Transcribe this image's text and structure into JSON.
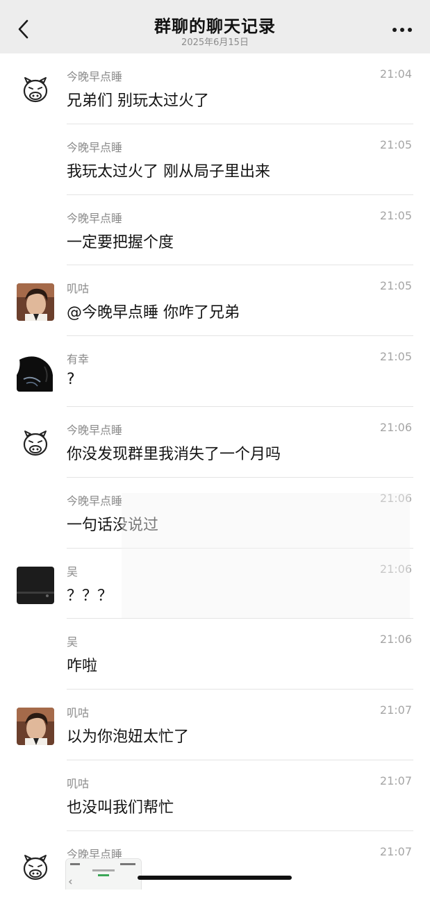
{
  "header": {
    "title": "群聊的聊天记录",
    "date": "2025年6月15日",
    "back_icon": "chevron-left-icon",
    "more_icon": "more-horizontal-icon",
    "background": "#ededed"
  },
  "messages": [
    {
      "sender": "今晚早点睡",
      "time": "21:04",
      "text": "兄弟们 别玩太过火了",
      "avatar": "pig"
    },
    {
      "sender": "今晚早点睡",
      "time": "21:05",
      "text": "我玩太过火了 刚从局子里出来",
      "avatar": ""
    },
    {
      "sender": "今晚早点睡",
      "time": "21:05",
      "text": "一定要把握个度",
      "avatar": ""
    },
    {
      "sender": "叽咕",
      "time": "21:05",
      "text": "@今晚早点睡 你咋了兄弟",
      "avatar": "portrait"
    },
    {
      "sender": "有幸",
      "time": "21:05",
      "text": "?",
      "avatar": "dark"
    },
    {
      "sender": "今晚早点睡",
      "time": "21:06",
      "text": "你没发现群里我消失了一个月吗",
      "avatar": "pig"
    },
    {
      "sender": "今晚早点睡",
      "time": "21:06",
      "text": "一句话没说过",
      "avatar": ""
    },
    {
      "sender": "吴",
      "time": "21:06",
      "text": "？？？",
      "avatar": "device"
    },
    {
      "sender": "吴",
      "time": "21:06",
      "text": "咋啦",
      "avatar": ""
    },
    {
      "sender": "叽咕",
      "time": "21:07",
      "text": "以为你泡妞太忙了",
      "avatar": "portrait"
    },
    {
      "sender": "叽咕",
      "time": "21:07",
      "text": "也没叫我们帮忙",
      "avatar": ""
    },
    {
      "sender": "今晚早点睡",
      "time": "21:07",
      "text": "",
      "avatar": "pig"
    }
  ]
}
